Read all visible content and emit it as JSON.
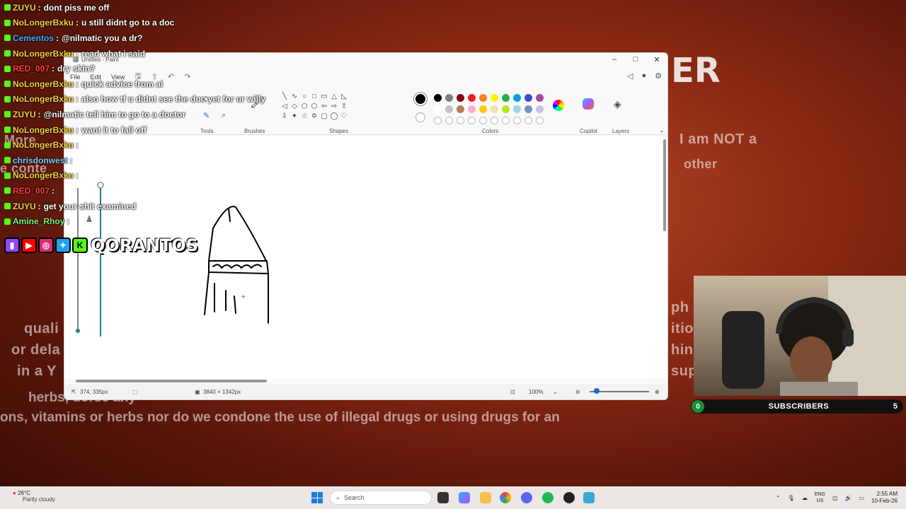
{
  "background": {
    "partial_big": "ER",
    "line1_right": "I am NOT a",
    "line2_right": "other",
    "left_cont": "e conte",
    "left_more": "More",
    "phrase_ph": "ph",
    "phrase_itio": "itio",
    "phrase_hin": "hin",
    "phrase_sup": "sup",
    "phrase_quali": "quali",
    "phrase_or_dela": "or dela",
    "phrase_in_a_y": "in a Y",
    "disclaimer_line1": "herbs,                                         dorse any",
    "disclaimer_line2": "ons, vitamins or herbs nor do we condone the use of illegal drugs or using drugs for an"
  },
  "chat": {
    "messages": [
      {
        "user": "ZUYU",
        "color": "#f5d23d",
        "text": "dont piss me off"
      },
      {
        "user": "NoLongerBxku",
        "color": "#f5d23d",
        "text": "u still didnt go to a doc"
      },
      {
        "user": "Cementos",
        "color": "#4aa8ff",
        "text": "@nilmatic you a dr?"
      },
      {
        "user": "NoLongerBxku",
        "color": "#f5d23d",
        "text": "read what i said"
      },
      {
        "user": "RED_007",
        "color": "#ff3b3b",
        "text": "dry skin?"
      },
      {
        "user": "NoLongerBxku",
        "color": "#f5d23d",
        "text": "quick advice from ai"
      },
      {
        "user": "NoLongerBxku",
        "color": "#f5d23d",
        "text": "also how tf u didnt see the doc yet for ur willy"
      },
      {
        "user": "ZUYU",
        "color": "#f5d23d",
        "text": "@nilmatic tell him to go to a doctor"
      },
      {
        "user": "NoLongerBxku",
        "color": "#f5d23d",
        "text": "want it to fall off"
      },
      {
        "user": "NoLongerBxku",
        "color": "#f5d23d",
        "text": ""
      },
      {
        "user": "chrisdonwest",
        "color": "#7ecbff",
        "text": ""
      },
      {
        "user": "NoLongerBxku",
        "color": "#f5d23d",
        "text": ""
      },
      {
        "user": "RED_007",
        "color": "#ff3b3b",
        "text": ""
      },
      {
        "user": "ZUYU",
        "color": "#f5d23d",
        "text": "get your shit examined"
      },
      {
        "user": "Amine_Rhoy",
        "color": "#7cf07c",
        "text": ""
      }
    ],
    "handle": "QORANTOS"
  },
  "paint": {
    "window_title": "Untitled - Paint",
    "menu": [
      "File",
      "Edit",
      "View"
    ],
    "groups": {
      "tools": "Tools",
      "brushes": "Brushes",
      "shapes": "Shapes",
      "colors": "Colors",
      "copilot": "Copilot",
      "layers": "Layers"
    },
    "palette_row1": [
      "#000000",
      "#7f7f7f",
      "#880015",
      "#ed1c24",
      "#ff7f27",
      "#fff200",
      "#22b14c",
      "#00a2e8",
      "#3f48cc",
      "#a349a4"
    ],
    "palette_row2": [
      "#ffffff",
      "#c3c3c3",
      "#b97a57",
      "#ffaec9",
      "#ffc90e",
      "#efe4b0",
      "#b5e61d",
      "#99d9ea",
      "#7092be",
      "#c8bfe7"
    ],
    "status": {
      "cursor": "374, 335px",
      "canvas_size": "3840 × 1342px",
      "zoom": "100%"
    }
  },
  "stream": {
    "subscribers_label": "SUBSCRIBERS",
    "subscribers_count": "0",
    "subscribers_goal": "5"
  },
  "taskbar": {
    "temperature": "26°C",
    "condition": "Partly cloudy",
    "search_placeholder": "Search",
    "lang_top": "ENG",
    "lang_bottom": "US",
    "time": "2:55 AM",
    "date": "10-Feb-26"
  }
}
